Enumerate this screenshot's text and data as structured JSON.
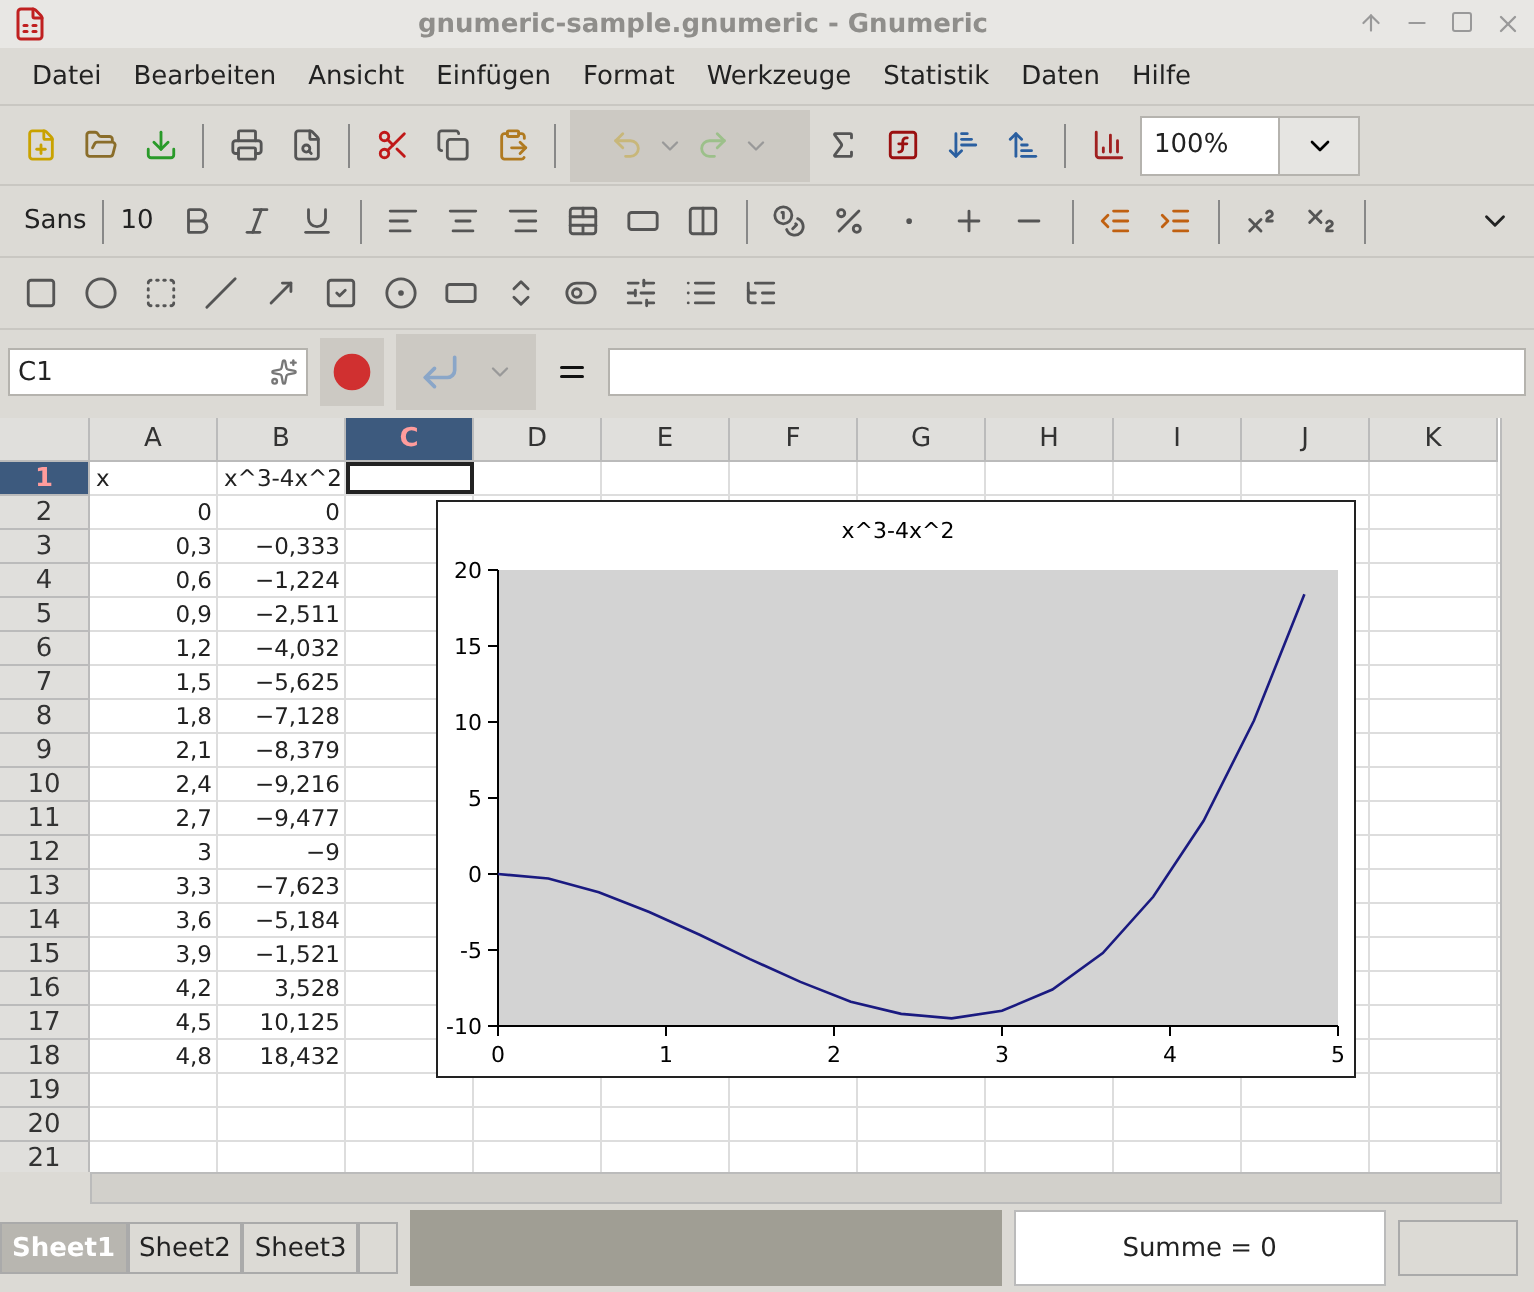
{
  "window": {
    "title": "gnumeric-sample.gnumeric - Gnumeric"
  },
  "menu": [
    "Datei",
    "Bearbeiten",
    "Ansicht",
    "Einfügen",
    "Format",
    "Werkzeuge",
    "Statistik",
    "Daten",
    "Hilfe"
  ],
  "toolbar": {
    "zoom": "100%",
    "font": "Sans",
    "font_size": "10",
    "undo_disabled": true
  },
  "formula_bar": {
    "cell_ref": "C1"
  },
  "columns": [
    {
      "label": "A",
      "selected": false
    },
    {
      "label": "B",
      "selected": false
    },
    {
      "label": "C",
      "selected": true
    },
    {
      "label": "D",
      "selected": false
    },
    {
      "label": "E",
      "selected": false
    },
    {
      "label": "F",
      "selected": false
    },
    {
      "label": "G",
      "selected": false
    },
    {
      "label": "H",
      "selected": false
    },
    {
      "label": "I",
      "selected": false
    },
    {
      "label": "J",
      "selected": false
    },
    {
      "label": "K",
      "selected": false
    }
  ],
  "rows": [
    {
      "label": "1",
      "selected": true,
      "kind": "text",
      "cells": [
        "x",
        "x^3-4x^2"
      ]
    },
    {
      "label": "2",
      "selected": false,
      "kind": "number",
      "cells": [
        "0",
        "0"
      ]
    },
    {
      "label": "3",
      "selected": false,
      "kind": "number",
      "cells": [
        "0,3",
        "−0,333"
      ]
    },
    {
      "label": "4",
      "selected": false,
      "kind": "number",
      "cells": [
        "0,6",
        "−1,224"
      ]
    },
    {
      "label": "5",
      "selected": false,
      "kind": "number",
      "cells": [
        "0,9",
        "−2,511"
      ]
    },
    {
      "label": "6",
      "selected": false,
      "kind": "number",
      "cells": [
        "1,2",
        "−4,032"
      ]
    },
    {
      "label": "7",
      "selected": false,
      "kind": "number",
      "cells": [
        "1,5",
        "−5,625"
      ]
    },
    {
      "label": "8",
      "selected": false,
      "kind": "number",
      "cells": [
        "1,8",
        "−7,128"
      ]
    },
    {
      "label": "9",
      "selected": false,
      "kind": "number",
      "cells": [
        "2,1",
        "−8,379"
      ]
    },
    {
      "label": "10",
      "selected": false,
      "kind": "number",
      "cells": [
        "2,4",
        "−9,216"
      ]
    },
    {
      "label": "11",
      "selected": false,
      "kind": "number",
      "cells": [
        "2,7",
        "−9,477"
      ]
    },
    {
      "label": "12",
      "selected": false,
      "kind": "number",
      "cells": [
        "3",
        "−9"
      ]
    },
    {
      "label": "13",
      "selected": false,
      "kind": "number",
      "cells": [
        "3,3",
        "−7,623"
      ]
    },
    {
      "label": "14",
      "selected": false,
      "kind": "number",
      "cells": [
        "3,6",
        "−5,184"
      ]
    },
    {
      "label": "15",
      "selected": false,
      "kind": "number",
      "cells": [
        "3,9",
        "−1,521"
      ]
    },
    {
      "label": "16",
      "selected": false,
      "kind": "number",
      "cells": [
        "4,2",
        "3,528"
      ]
    },
    {
      "label": "17",
      "selected": false,
      "kind": "number",
      "cells": [
        "4,5",
        "10,125"
      ]
    },
    {
      "label": "18",
      "selected": false,
      "kind": "number",
      "cells": [
        "4,8",
        "18,432"
      ]
    },
    {
      "label": "19",
      "selected": false
    },
    {
      "label": "20",
      "selected": false
    },
    {
      "label": "21",
      "selected": false
    }
  ],
  "chart": {
    "chart_data": {
      "type": "line",
      "title": "x^3-4x^2",
      "x": [
        0,
        0.3,
        0.6,
        0.9,
        1.2,
        1.5,
        1.8,
        2.1,
        2.4,
        2.7,
        3,
        3.3,
        3.6,
        3.9,
        4.2,
        4.5,
        4.8
      ],
      "series": [
        {
          "color": "#1a1a80",
          "values": [
            0,
            -0.3,
            -1.2,
            -2.5,
            -4,
            -5.6,
            -7.1,
            -8.4,
            -9.2,
            -9.5,
            -9,
            -7.6,
            -5.2,
            -1.5,
            3.5,
            10.1,
            18.4
          ]
        }
      ],
      "xlim": [
        0,
        5
      ],
      "ylim": [
        -10,
        20
      ],
      "xticks": [
        0,
        1,
        2,
        3,
        4,
        5
      ],
      "yticks": [
        -10,
        -5,
        0,
        5,
        10,
        15,
        20
      ]
    }
  },
  "sheets": [
    {
      "label": "Sheet1",
      "selected": true
    },
    {
      "label": "Sheet2",
      "selected": false
    },
    {
      "label": "Sheet3",
      "selected": false
    }
  ],
  "status": {
    "summary": "Summe = 0"
  }
}
